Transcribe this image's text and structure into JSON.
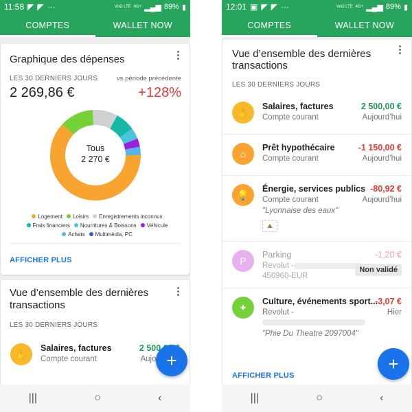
{
  "left": {
    "status": {
      "time": "11:58",
      "battery": "89%",
      "net_small_1": "VoΩ\nLTE",
      "net_small_2": "4G+"
    },
    "tabs": [
      {
        "label": "COMPTES"
      },
      {
        "label": "WALLET NOW"
      }
    ],
    "expenses_card": {
      "title": "Graphique des dépenses",
      "period_label": "LES 30 DERNIERS JOURS",
      "compare_label": "vs période précédente",
      "total": "2 269,86 €",
      "change": "+128%",
      "donut_center_label": "Tous",
      "donut_center_value": "2 270 €",
      "show_more": "AFFICHER PLUS"
    },
    "chart_data": {
      "type": "pie",
      "categories": [
        "Logement",
        "Loisirs",
        "Enregistrements inconnus",
        "Frais financiers",
        "Nourritures & Boissons",
        "Véhicule",
        "Achats",
        "Multimédia, PC"
      ],
      "values": [
        62,
        12,
        9,
        7,
        4,
        3,
        3,
        0
      ],
      "colors": [
        "#f9a430",
        "#74d138",
        "#d0d0d0",
        "#14b8a6",
        "#49c4d9",
        "#9b1fe0",
        "#56b4e9",
        "#2f5fb6"
      ],
      "center_label": "Tous",
      "center_value": "2 270 €"
    },
    "transactions_card": {
      "title_line1": "Vue d’ensemble des dernières",
      "title_line2": "transactions",
      "period_label": "LES 30 DERNIERS JOURS",
      "row": {
        "name": "Salaires, factures",
        "account": "Compte courant",
        "amount": "2 500,00 €",
        "date": "Aujourd’hui"
      }
    },
    "fab": "+"
  },
  "right": {
    "status": {
      "time": "12:01",
      "battery": "89%",
      "net_small_1": "VoΩ\nLTE",
      "net_small_2": "4G+"
    },
    "tabs": [
      {
        "label": "COMPTES"
      },
      {
        "label": "WALLET NOW"
      }
    ],
    "card": {
      "title_line1": "Vue d’ensemble des dernières",
      "title_line2": "transactions",
      "period_label": "LES 30 DERNIERS JOURS",
      "show_more": "AFFICHER PLUS"
    },
    "transactions": [
      {
        "name": "Salaires, factures",
        "account": "Compte courant",
        "amount": "2 500,00 €",
        "date": "Aujourd’hui",
        "color": "#f7b928",
        "icon": "hand-coin-icon"
      },
      {
        "name": "Prêt hypothécaire",
        "account": "Compte courant",
        "amount": "-1 150,00 €",
        "date": "Aujourd’hui",
        "color": "#f9a430",
        "icon": "house-dollar-icon"
      },
      {
        "name": "Énergie, services publics",
        "account": "Compte courant",
        "amount": "-80,92 €",
        "date": "Aujourd’hui",
        "note": "\"Lyonnaise des eaux\"",
        "color": "#f9a430",
        "icon": "lightbulb-icon"
      },
      {
        "name": "Parking",
        "account": "Revolut -",
        "account_line2": "456960-EUR",
        "amount": "-1,20 €",
        "badge": "Non validé",
        "color": "#e2a1e8",
        "icon": "parking-icon"
      },
      {
        "name": "Culture, événements sport...",
        "account": "Revolut -",
        "amount": "-3,07 €",
        "date": "Hier",
        "note": "\"Phie Du Theatre 2097004\"",
        "color": "#74d138",
        "icon": "party-icon"
      }
    ],
    "fab": "+"
  },
  "nav": {
    "recent": "|||",
    "home": "○",
    "back": "‹"
  }
}
